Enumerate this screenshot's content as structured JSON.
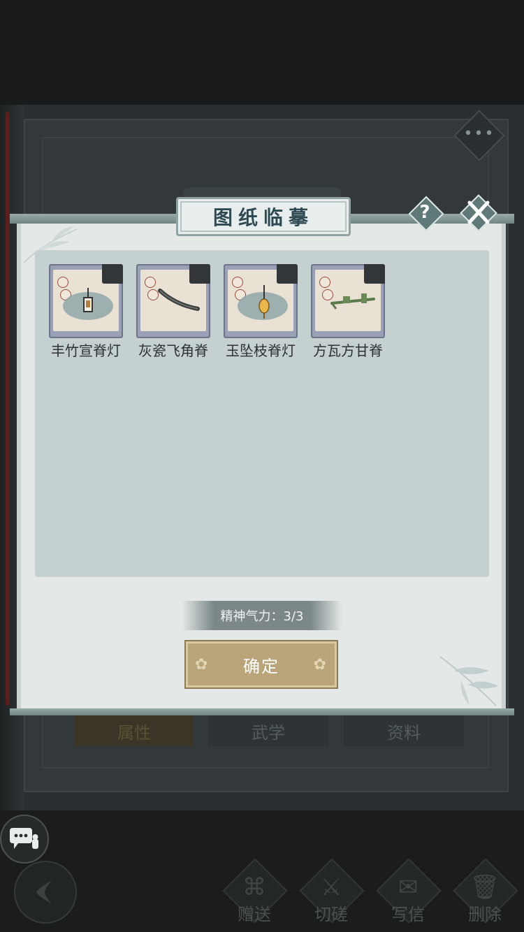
{
  "background": {
    "tabs": [
      "属性",
      "武学",
      "资料"
    ],
    "actions": [
      {
        "label": "赠送",
        "icon": "scroll-icon"
      },
      {
        "label": "切磋",
        "icon": "sword-icon"
      },
      {
        "label": "写信",
        "icon": "letter-icon"
      },
      {
        "label": "删除",
        "icon": "trash-icon"
      }
    ]
  },
  "dialog": {
    "title": "图纸临摹",
    "items": [
      {
        "name": "丰竹宣脊灯",
        "icon": "lantern-icon"
      },
      {
        "name": "灰瓷飞角脊",
        "icon": "curved-ridge-icon"
      },
      {
        "name": "玉坠枝脊灯",
        "icon": "hanging-lantern-icon"
      },
      {
        "name": "方瓦方甘脊",
        "icon": "straight-ridge-icon"
      }
    ],
    "energy_label": "精神气力：3/3",
    "confirm_label": "确定"
  },
  "colors": {
    "dialog_bg": "#e4e9e8",
    "panel_bg": "#c5d0d0",
    "confirm_bg": "#b9a579",
    "frame": "#9aa0b6"
  }
}
